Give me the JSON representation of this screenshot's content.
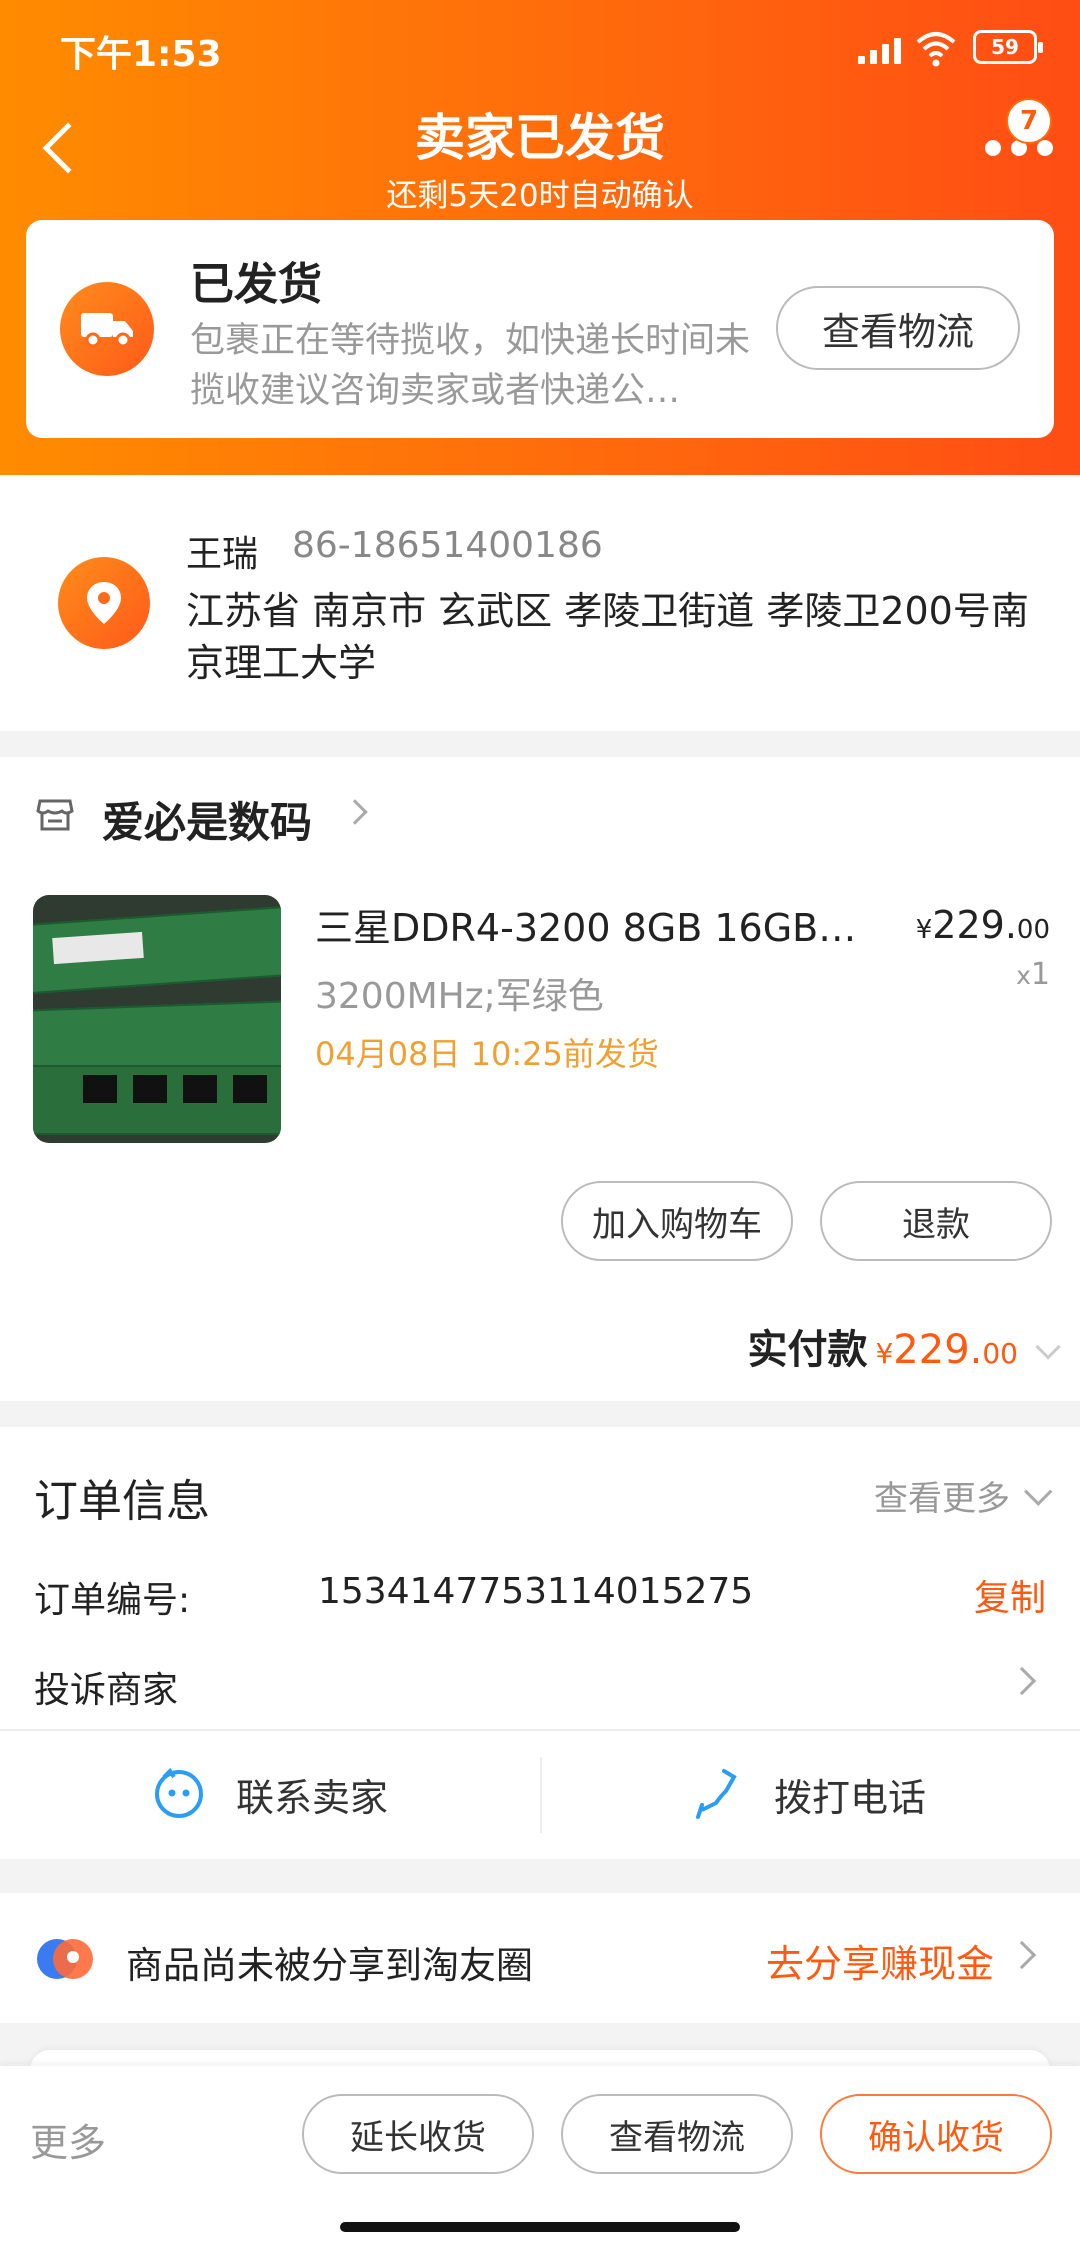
{
  "status_bar": {
    "time": "下午1:53",
    "battery": "59"
  },
  "header": {
    "title": "卖家已发货",
    "subtitle": "还剩5天20时自动确认",
    "more_badge": "7"
  },
  "shipping_card": {
    "title": "已发货",
    "desc": "包裹正在等待揽收，如快递长时间未揽收建议咨询卖家或者快递公…",
    "track_button": "查看物流"
  },
  "address": {
    "name": "王瑞",
    "phone": "86-18651400186",
    "detail": "江苏省 南京市 玄武区 孝陵卫街道 孝陵卫200号南京理工大学"
  },
  "shop": {
    "name": "爱必是数码"
  },
  "product": {
    "name": "三星DDR4-3200 8GB 16GB …",
    "spec": "3200MHz;军绿色",
    "ship_time": "04月08日 10:25前发货",
    "price_main": "229.",
    "price_cents": "00",
    "currency": "¥",
    "qty": "1",
    "qty_prefix": "x"
  },
  "actions": {
    "add_cart": "加入购物车",
    "refund": "退款"
  },
  "paid": {
    "label": "实付款",
    "currency": "¥",
    "amount_main": "229.",
    "amount_cents": "00"
  },
  "order_info": {
    "title": "订单信息",
    "view_more": "查看更多",
    "order_no_label": "订单编号:",
    "order_no": "1534147753114015275",
    "copy": "复制",
    "complain": "投诉商家",
    "contact_seller": "联系卖家",
    "call": "拨打电话"
  },
  "share": {
    "text": "商品尚未被分享到淘友圈",
    "action": "去分享赚现金"
  },
  "bottom_bar": {
    "more": "更多",
    "extend": "延长收货",
    "track": "查看物流",
    "confirm": "确认收货"
  },
  "colors": {
    "accent": "#ff5a0f",
    "header_start": "#ff8c00",
    "header_end": "#ff4d14",
    "ship_time": "#f0a030"
  }
}
